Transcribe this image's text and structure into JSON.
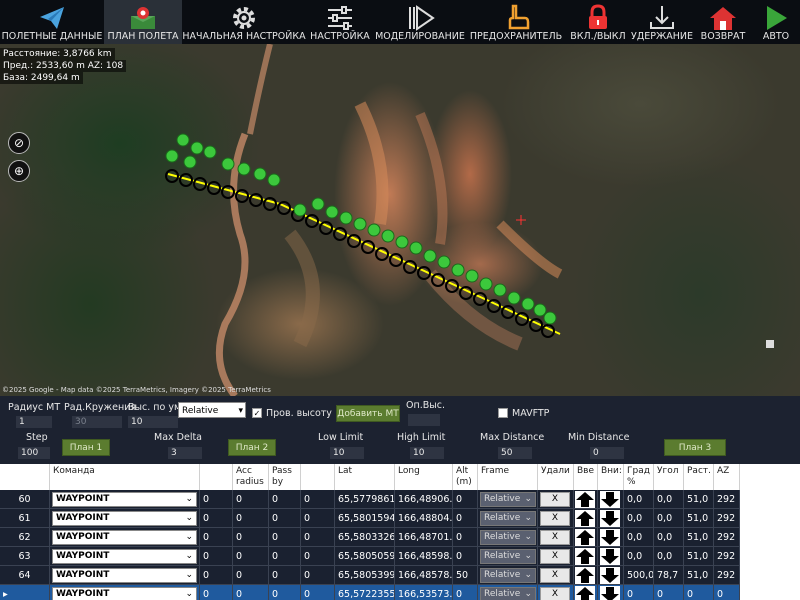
{
  "toolbar": {
    "items": [
      {
        "label": "ПОЛЕТНЫЕ ДАННЫЕ",
        "icon": "paper-plane-icon"
      },
      {
        "label": "ПЛАН ПОЛЕТА",
        "icon": "map-pin-icon"
      },
      {
        "label": "НАЧАЛЬНАЯ НАСТРОЙКА",
        "icon": "gear-icon"
      },
      {
        "label": "НАСТРОЙКА",
        "icon": "sliders-icon"
      },
      {
        "label": "МОДЕЛИРОВАНИЕ",
        "icon": "play-icon"
      },
      {
        "label": "ПРЕДОХРАНИТЕЛЬ",
        "icon": "hand-icon"
      },
      {
        "label": "ВКЛ./ВЫКЛ",
        "icon": "lock-icon"
      },
      {
        "label": "УДЕРЖАНИЕ",
        "icon": "download-icon"
      },
      {
        "label": "ВОЗВРАТ",
        "icon": "home-icon"
      },
      {
        "label": "АВТО",
        "icon": "play-green-icon"
      }
    ],
    "active_index": 1
  },
  "map": {
    "distance": "Расстояние: 3,8766 km",
    "prev": "Пред.: 2533,60 m AZ: 108",
    "base": "База: 2499,64 m",
    "attribution": "©2025 Google - Map data ©2025 TerraMetrics, Imagery ©2025 TerraMetrics"
  },
  "form": {
    "radius_label": "Радиус МТ",
    "radius_value": "1",
    "loiter_label": "Рад.Кружения",
    "loiter_value": "30",
    "default_alt_label": "Выс. по ум.",
    "default_alt_value": "10",
    "alt_mode": "Relative",
    "verify_height_label": "Пров. высоту",
    "add_wp_label": "Добавить МТ",
    "home_alt_label": "Оп.Выс.",
    "mavftp_label": "MAVFTP",
    "step_label": "Step",
    "step_value": "100",
    "plan1_label": "План 1",
    "max_delta_label": "Max Delta",
    "max_delta_value": "3",
    "plan2_label": "План 2",
    "low_limit_label": "Low Limit",
    "low_limit_value": "10",
    "high_limit_label": "High Limit",
    "high_limit_value": "10",
    "max_distance_label": "Max Distance",
    "max_distance_value": "50",
    "min_distance_label": "Min Distance",
    "min_distance_value": "0",
    "plan3_label": "План 3"
  },
  "table": {
    "headers": [
      "",
      "Команда",
      "",
      "Acc radius",
      "Pass by",
      "",
      "Lat",
      "Long",
      "Alt (m)",
      "Frame",
      "Удали",
      "Вве",
      "Вни:",
      "Град %",
      "Угол",
      "Раст.",
      "AZ"
    ],
    "rows": [
      {
        "num": "60",
        "cmd": "WAYPOINT",
        "p1": "0",
        "p2": "0",
        "p3": "0",
        "p4": "0",
        "lat": "65,5779861",
        "long": "166,48906...",
        "alt": "0",
        "frame": "Relative",
        "del": "X",
        "grad": "0,0",
        "angle": "0,0",
        "dist": "51,0",
        "az": "292"
      },
      {
        "num": "61",
        "cmd": "WAYPOINT",
        "p1": "0",
        "p2": "0",
        "p3": "0",
        "p4": "0",
        "lat": "65,5801594",
        "long": "166,48804...",
        "alt": "0",
        "frame": "Relative",
        "del": "X",
        "grad": "0,0",
        "angle": "0,0",
        "dist": "51,0",
        "az": "292"
      },
      {
        "num": "62",
        "cmd": "WAYPOINT",
        "p1": "0",
        "p2": "0",
        "p3": "0",
        "p4": "0",
        "lat": "65,5803326",
        "long": "166,48701...",
        "alt": "0",
        "frame": "Relative",
        "del": "X",
        "grad": "0,0",
        "angle": "0,0",
        "dist": "51,0",
        "az": "292"
      },
      {
        "num": "63",
        "cmd": "WAYPOINT",
        "p1": "0",
        "p2": "0",
        "p3": "0",
        "p4": "0",
        "lat": "65,5805059",
        "long": "166,48598...",
        "alt": "0",
        "frame": "Relative",
        "del": "X",
        "grad": "0,0",
        "angle": "0,0",
        "dist": "51,0",
        "az": "292"
      },
      {
        "num": "64",
        "cmd": "WAYPOINT",
        "p1": "0",
        "p2": "0",
        "p3": "0",
        "p4": "0",
        "lat": "65,5805399",
        "long": "166,48578...",
        "alt": "50",
        "frame": "Relative",
        "del": "X",
        "grad": "500,0",
        "angle": "78,7",
        "dist": "51,0",
        "az": "292"
      },
      {
        "num": "",
        "cmd": "WAYPOINT",
        "p1": "0",
        "p2": "0",
        "p3": "0",
        "p4": "0",
        "lat": "65,5722355",
        "long": "166,53573...",
        "alt": "0",
        "frame": "Relative",
        "del": "X",
        "grad": "0",
        "angle": "0",
        "dist": "0",
        "az": "0"
      }
    ],
    "selected_row_marker": "▸"
  }
}
